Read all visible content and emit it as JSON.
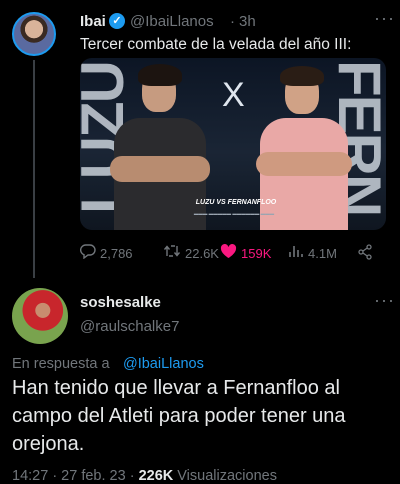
{
  "tweet": {
    "author_name": "Ibai",
    "author_handle": "@IbaiLlanos",
    "separator": "·",
    "time": "3h",
    "text": "Tercer combate de la velada del año III:",
    "media": {
      "left_name_vertical": "LUZU",
      "right_name_vertical": "FERN",
      "versus": "X",
      "banner": "LUZU VS FERNANFLOO"
    },
    "stats": {
      "replies": "2,786",
      "retweets": "22.6K",
      "likes": "159K",
      "views": "4.1M"
    }
  },
  "reply": {
    "author_name": "soshesalke",
    "author_handle": "@raulschalke7",
    "reply_prefix": "En respuesta a",
    "reply_to": "@IbaiLlanos",
    "text": "Han tenido que llevar a Fernanfloo al campo del Atleti para poder tener una orejona.",
    "timestamp": "14:27 · 27 feb. 23 ·",
    "views_count": "226K",
    "views_label": "Visualizaciones"
  },
  "icons": {
    "reply": "comment-icon",
    "retweet": "retweet-icon",
    "like": "heart-icon",
    "views": "bar-chart-icon",
    "share": "share-icon"
  },
  "colors": {
    "background": "#000000",
    "accent": "#1d9bf0",
    "like": "#f91880",
    "muted": "#71767b"
  }
}
